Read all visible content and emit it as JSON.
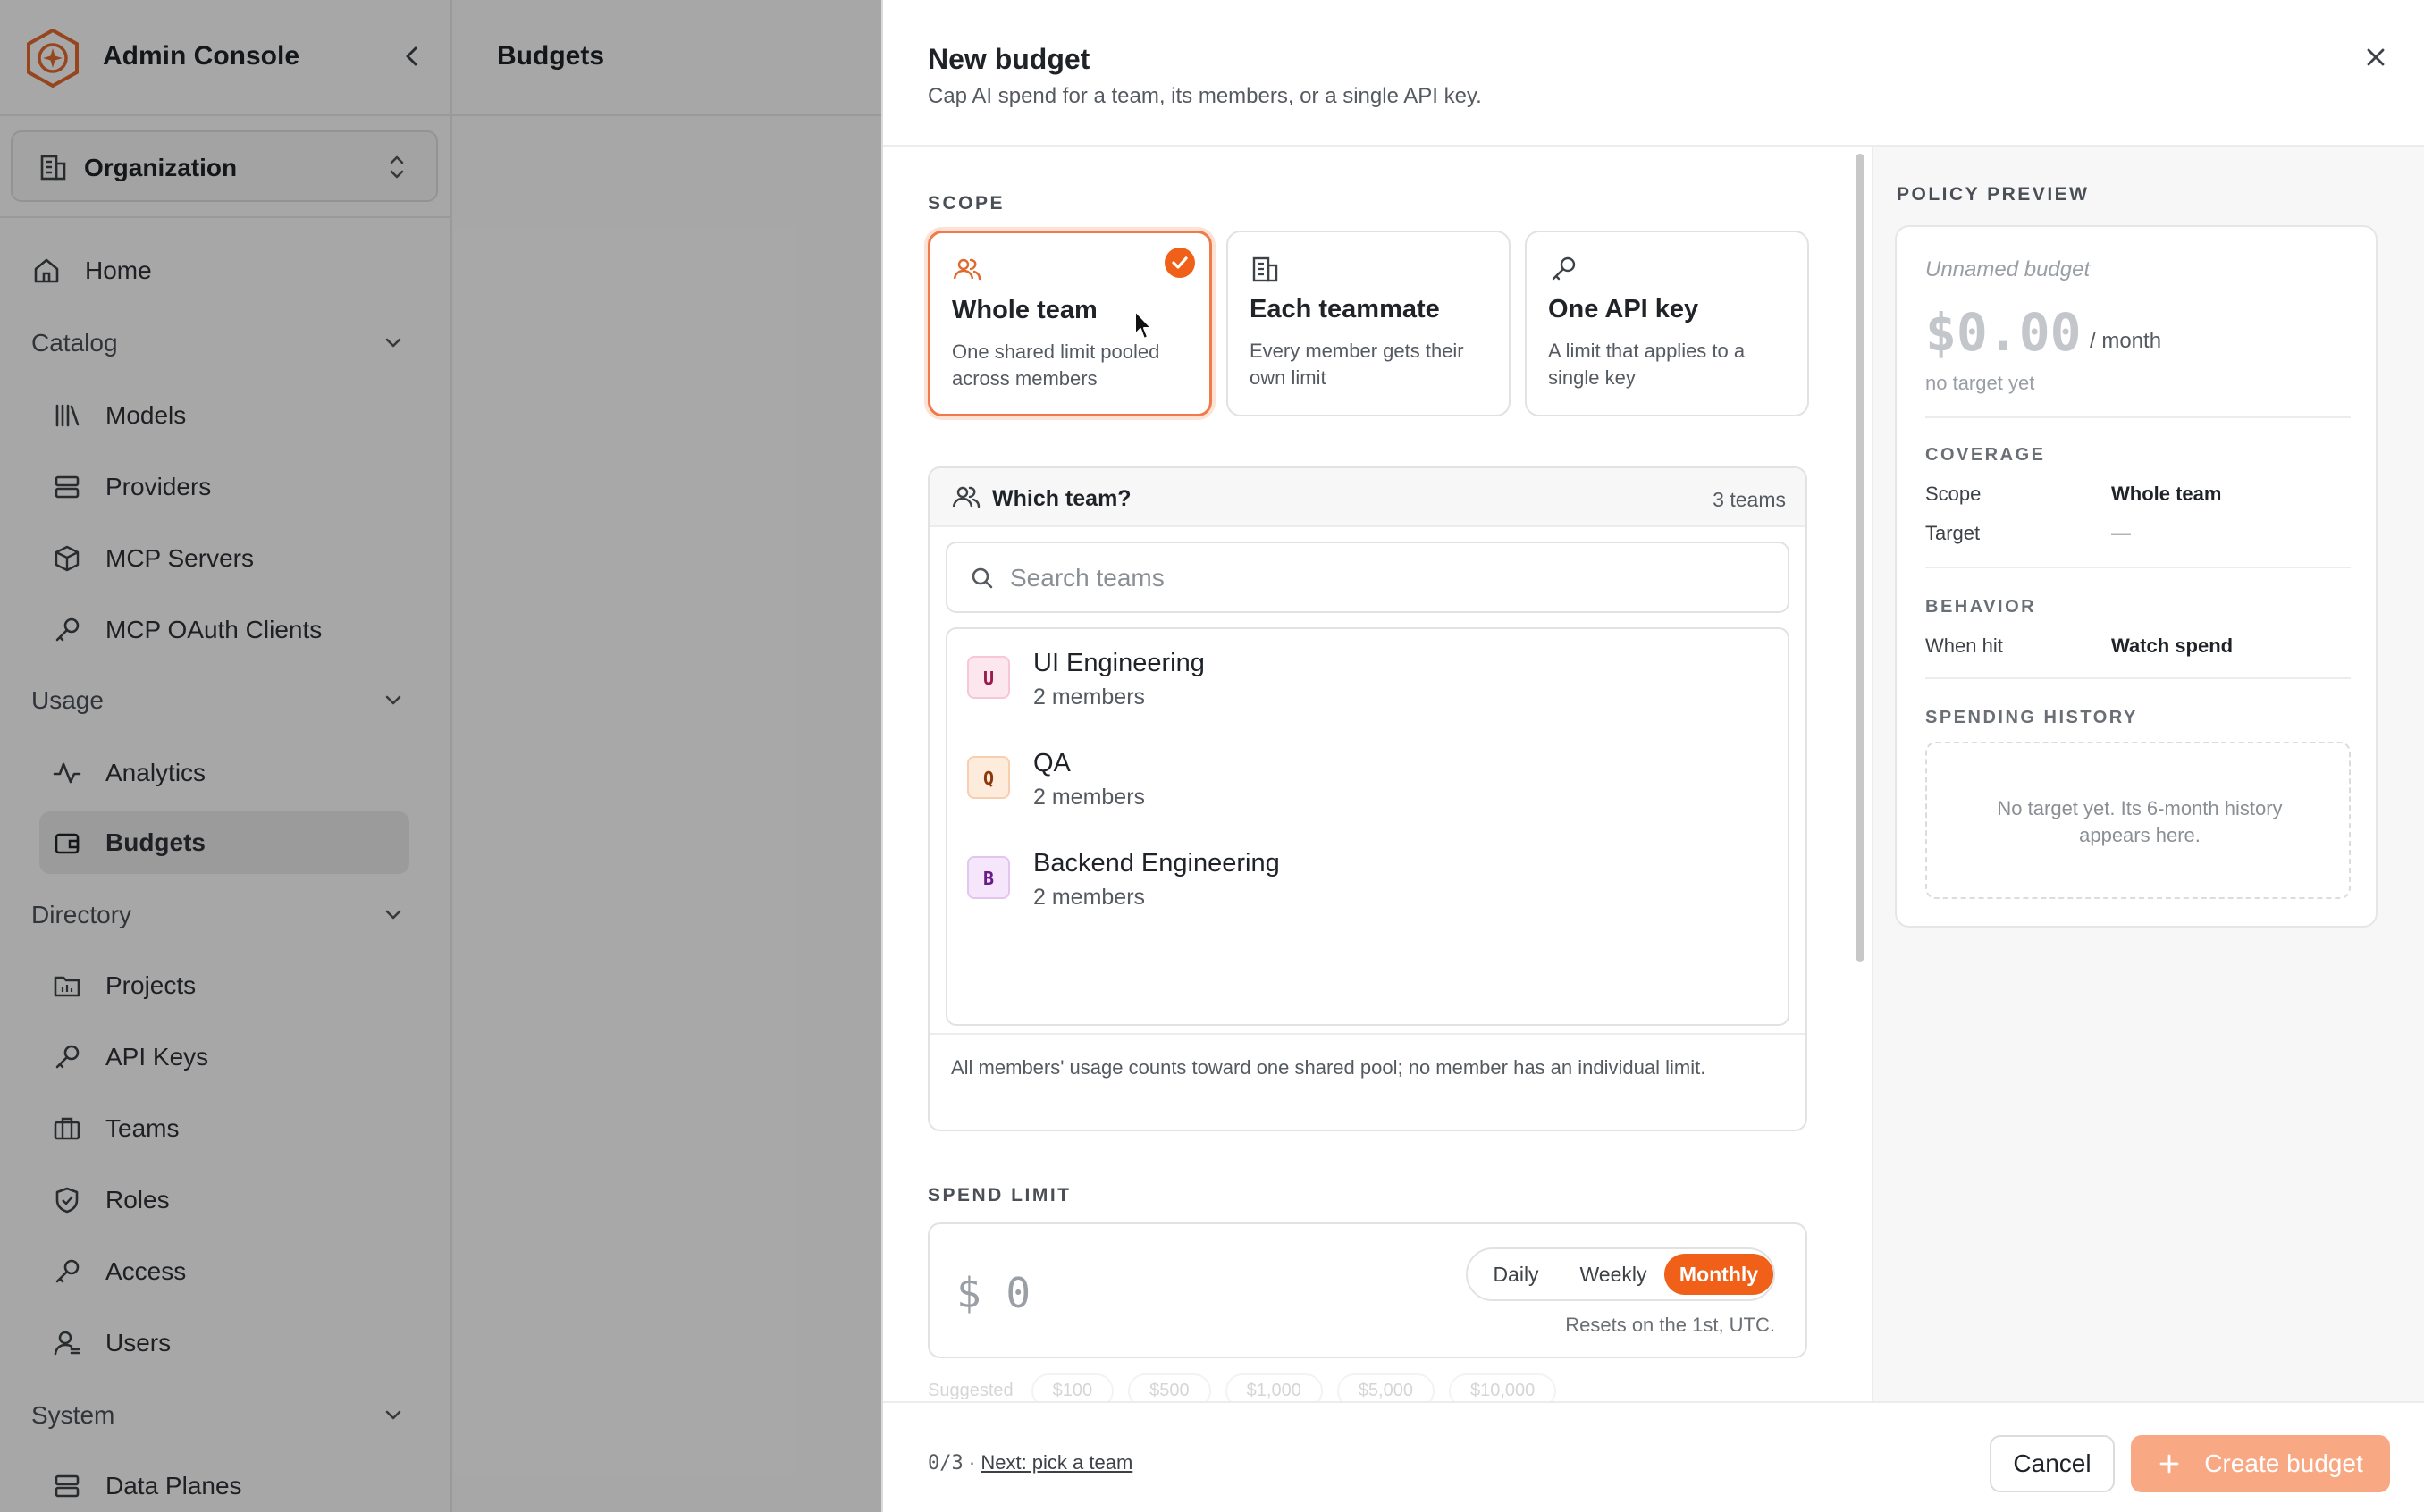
{
  "app": {
    "title": "Admin Console",
    "org_selector": "Organization"
  },
  "sidebar": {
    "home": "Home",
    "sections": {
      "catalog": "Catalog",
      "usage": "Usage",
      "directory": "Directory",
      "system": "System"
    },
    "catalog_items": [
      "Models",
      "Providers",
      "MCP Servers",
      "MCP OAuth Clients"
    ],
    "usage_items": [
      "Analytics",
      "Budgets"
    ],
    "directory_items": [
      "Projects",
      "API Keys",
      "Teams",
      "Roles",
      "Access",
      "Users"
    ],
    "system_items": [
      "Data Planes"
    ],
    "active_item": "Budgets"
  },
  "main": {
    "title": "Budgets"
  },
  "drawer": {
    "title": "New budget",
    "subtitle": "Cap AI spend for a team, its members, or a single API key.",
    "scope": {
      "label": "SCOPE",
      "options": [
        {
          "title": "Whole team",
          "desc": "One shared limit pooled across members",
          "icon": "users-icon",
          "selected": true
        },
        {
          "title": "Each teammate",
          "desc": "Every member gets their own limit",
          "icon": "building-icon",
          "selected": false
        },
        {
          "title": "One API key",
          "desc": "A limit that applies to a single key",
          "icon": "key-icon",
          "selected": false
        }
      ]
    },
    "team_picker": {
      "label": "Which team?",
      "count": "3 teams",
      "search_placeholder": "Search teams",
      "teams": [
        {
          "initial": "U",
          "name": "UI Engineering",
          "members": "2 members",
          "color": "#fde7ef",
          "text_color": "#9b1c4a"
        },
        {
          "initial": "Q",
          "name": "QA",
          "members": "2 members",
          "color": "#fdebdc",
          "text_color": "#8a3a0a"
        },
        {
          "initial": "B",
          "name": "Backend Engineering",
          "members": "2 members",
          "color": "#f5e6fb",
          "text_color": "#6a1b8a"
        }
      ],
      "note": "All members' usage counts toward one shared pool; no member has an individual limit."
    },
    "spend_limit": {
      "label": "SPEND LIMIT",
      "currency": "$",
      "amount": "0",
      "periods": [
        "Daily",
        "Weekly",
        "Monthly"
      ],
      "active_period": "Monthly",
      "resets_note": "Resets on the 1st, UTC.",
      "suggested_label": "Suggested",
      "suggested": [
        "$100",
        "$500",
        "$1,000",
        "$5,000",
        "$10,000"
      ]
    },
    "preview": {
      "label": "POLICY PREVIEW",
      "name": "Unnamed budget",
      "amount": "$0.00",
      "period": "/ month",
      "target_note": "no target yet",
      "coverage_label": "COVERAGE",
      "scope_key": "Scope",
      "scope_val": "Whole team",
      "target_key": "Target",
      "target_val": "—",
      "behavior_label": "BEHAVIOR",
      "when_hit_key": "When hit",
      "when_hit_val": "Watch spend",
      "history_label": "SPENDING HISTORY",
      "history_empty": "No target yet. Its 6-month history appears here."
    },
    "footer": {
      "progress": "0/3",
      "separator": "·",
      "next_link": "Next: pick a team",
      "cancel": "Cancel",
      "create": "Create budget"
    }
  },
  "colors": {
    "accent": "#f06018",
    "accent_soft": "#f9a884",
    "selected_border": "#f07a4a"
  }
}
